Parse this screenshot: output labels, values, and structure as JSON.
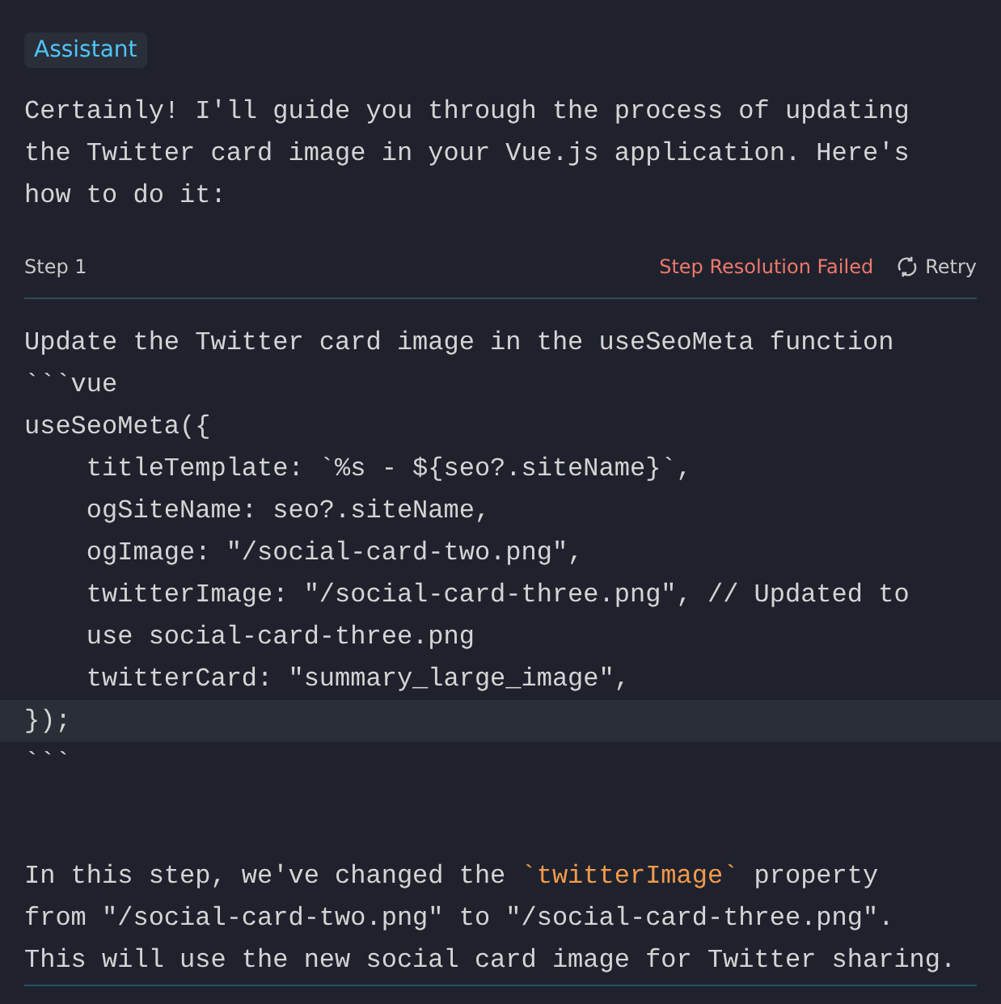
{
  "role_badge": "Assistant",
  "intro": "Certainly! I'll guide you through the process of updating the Twitter card image in your Vue.js application. Here's how to do it:",
  "step": {
    "label": "Step 1",
    "status": "Step Resolution Failed",
    "retry": "Retry"
  },
  "code_lines": [
    {
      "text": "Update the Twitter card image in the useSeoMeta function",
      "highlighted": false
    },
    {
      "text": "```vue",
      "highlighted": false
    },
    {
      "text": "useSeoMeta({",
      "highlighted": false
    },
    {
      "text": "    titleTemplate: `%s - ${seo?.siteName}`,",
      "highlighted": false
    },
    {
      "text": "    ogSiteName: seo?.siteName,",
      "highlighted": false
    },
    {
      "text": "    ogImage: \"/social-card-two.png\",",
      "highlighted": false
    },
    {
      "text": "    twitterImage: \"/social-card-three.png\", // Updated to",
      "highlighted": false
    },
    {
      "text": "    use social-card-three.png",
      "highlighted": false
    },
    {
      "text": "    twitterCard: \"summary_large_image\",",
      "highlighted": false
    },
    {
      "text": "});",
      "highlighted": true
    },
    {
      "text": "```",
      "highlighted": false
    }
  ],
  "summary_lines": [
    [
      {
        "kind": "text",
        "text": "In this step, we've changed the "
      },
      {
        "kind": "code",
        "text": "`twitterImage`"
      },
      {
        "kind": "text",
        "text": " property"
      }
    ],
    [
      {
        "kind": "text",
        "text": "from \"/social-card-two.png\" to \"/social-card-three.png\"."
      }
    ],
    [
      {
        "kind": "text",
        "text": "This will use the new social card image for Twitter sharing."
      }
    ]
  ]
}
